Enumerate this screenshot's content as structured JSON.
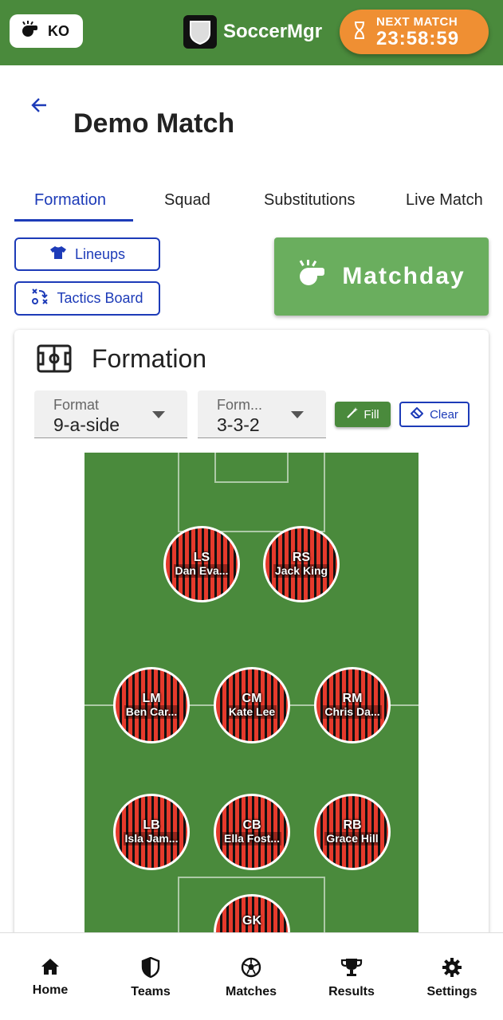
{
  "topbar": {
    "ko_label": "KO",
    "app_name": "SoccerMgr",
    "next_match_label": "NEXT MATCH",
    "next_match_time": "23:58:59"
  },
  "header": {
    "title": "Demo Match"
  },
  "tabs": [
    {
      "label": "Formation",
      "active": true
    },
    {
      "label": "Squad",
      "active": false
    },
    {
      "label": "Substitutions",
      "active": false
    },
    {
      "label": "Live Match",
      "active": false
    }
  ],
  "actions": {
    "lineups_label": "Lineups",
    "tactics_label": "Tactics Board",
    "matchday_label": "Matchday"
  },
  "formation_card": {
    "title": "Formation",
    "format_label": "Format",
    "format_value": "9-a-side",
    "formation_label": "Form...",
    "formation_value": "3-3-2",
    "fill_label": "Fill",
    "clear_label": "Clear"
  },
  "players": [
    {
      "pos": "LS",
      "name": "Dan Eva..."
    },
    {
      "pos": "RS",
      "name": "Jack King"
    },
    {
      "pos": "LM",
      "name": "Ben Car..."
    },
    {
      "pos": "CM",
      "name": "Kate Lee"
    },
    {
      "pos": "RM",
      "name": "Chris Da..."
    },
    {
      "pos": "LB",
      "name": "Isla Jam..."
    },
    {
      "pos": "CB",
      "name": "Ella Fost..."
    },
    {
      "pos": "RB",
      "name": "Grace Hill"
    },
    {
      "pos": "GK",
      "name": ""
    }
  ],
  "bottom_nav": [
    {
      "label": "Home",
      "icon": "home-icon"
    },
    {
      "label": "Teams",
      "icon": "shield-icon"
    },
    {
      "label": "Matches",
      "icon": "soccer-ball-icon"
    },
    {
      "label": "Results",
      "icon": "trophy-icon"
    },
    {
      "label": "Settings",
      "icon": "gear-icon"
    }
  ],
  "colors": {
    "brand_green": "#4a8a3c",
    "accent_orange": "#ef8f33",
    "primary_blue": "#1d3bb8",
    "matchday_green": "#6aae5e"
  }
}
